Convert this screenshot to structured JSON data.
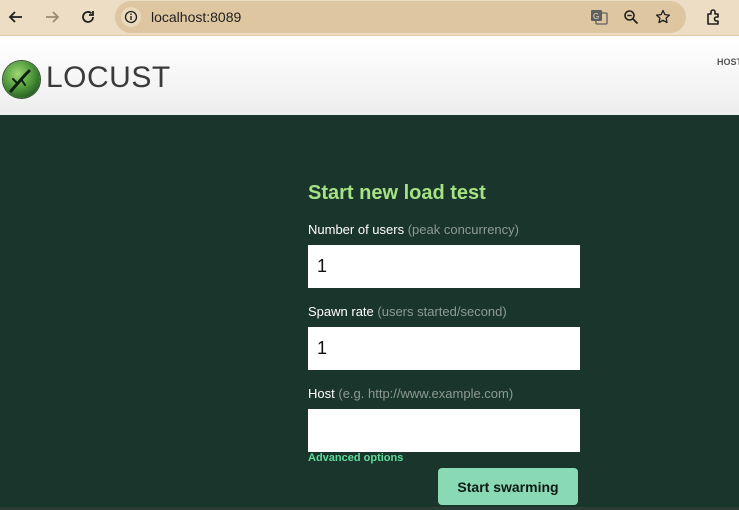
{
  "browser": {
    "url": "localhost:8089",
    "icons": {
      "back": "arrow-left-icon",
      "forward": "arrow-right-icon",
      "reload": "reload-icon",
      "info": "info-icon",
      "translate": "translate-icon",
      "zoom": "zoom-out-icon",
      "bookmark": "star-icon",
      "extensions": "puzzle-icon"
    }
  },
  "header": {
    "logo_text": "LOCUST",
    "host_label": "HOST"
  },
  "form": {
    "title": "Start new load test",
    "users": {
      "label": "Number of users",
      "hint": "(peak concurrency)",
      "value": "1"
    },
    "spawn_rate": {
      "label": "Spawn rate",
      "hint": "(users started/second)",
      "value": "1"
    },
    "host": {
      "label": "Host",
      "hint": "(e.g. http://www.example.com)",
      "value": ""
    },
    "advanced_label": "Advanced options",
    "submit_label": "Start swarming"
  },
  "colors": {
    "page_background": "#1a352b",
    "title_green": "#a6e283",
    "button_green": "#88d9b4",
    "link_green": "#5fdc9b",
    "browser_bar": "#ecddc4"
  }
}
